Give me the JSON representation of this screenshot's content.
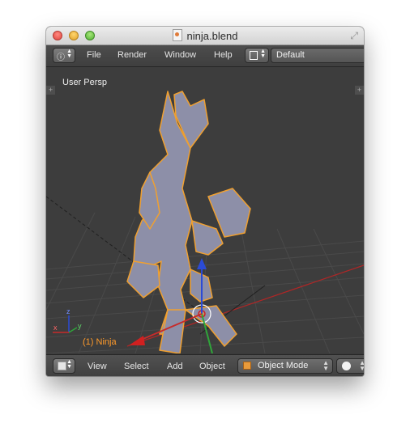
{
  "window": {
    "title": "ninja.blend",
    "icons": {
      "document": "blend-file-icon",
      "fullscreen": "fullscreen-icon"
    }
  },
  "header": {
    "menus": [
      "File",
      "Render",
      "Window",
      "Help"
    ],
    "screen_layout": "Default"
  },
  "viewport": {
    "view_label": "User Persp",
    "object_label": "(1) Ninja",
    "axis_labels": {
      "x": "x",
      "y": "y",
      "z": "z"
    },
    "colors": {
      "background": "#3d3d3d",
      "selection_outline": "#f0a030",
      "x_axis": "#c62b2b",
      "y_axis": "#2fa63a",
      "z_axis": "#2b4bd6"
    }
  },
  "footer": {
    "menus": [
      "View",
      "Select",
      "Add",
      "Object"
    ],
    "mode": "Object Mode"
  }
}
